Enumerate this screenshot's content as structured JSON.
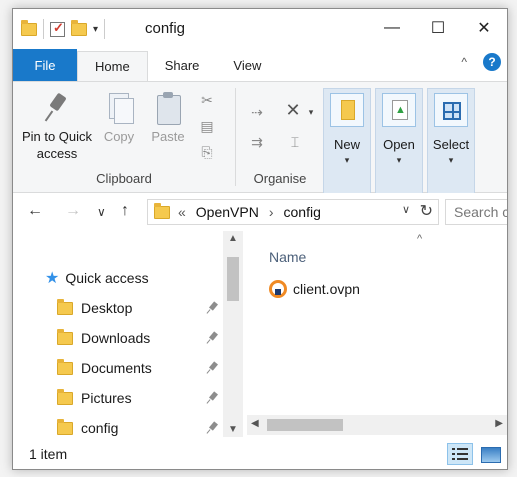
{
  "window": {
    "title": "config",
    "controls": {
      "minimize": "—",
      "maximize": "☐",
      "close": "✕"
    }
  },
  "quick_access_toolbar": {
    "caret": "▾"
  },
  "ribbon_tabs": [
    {
      "label": "File"
    },
    {
      "label": "Home",
      "active": true
    },
    {
      "label": "Share"
    },
    {
      "label": "View"
    }
  ],
  "ribbon_controls": {
    "collapse": "^",
    "help": "?"
  },
  "ribbon": {
    "clipboard": {
      "pin_label": "Pin to Quick access",
      "copy_label": "Copy",
      "paste_label": "Paste",
      "group_label": "Clipboard"
    },
    "organise": {
      "group_label": "Organise",
      "delete_glyph": "✕"
    },
    "new_label": "New",
    "open_label": "Open",
    "select_label": "Select",
    "caret": "▾"
  },
  "address": {
    "back": "←",
    "forward": "→",
    "recent": "∨",
    "up": "↑",
    "overflow": "«",
    "path": [
      "OpenVPN",
      "config"
    ],
    "separator": "›",
    "dropdown": "∨",
    "refresh": "↻",
    "search_placeholder": "Search co"
  },
  "nav_pane": {
    "quick_access_label": "Quick access",
    "items": [
      {
        "label": "Desktop",
        "pinned": true
      },
      {
        "label": "Downloads",
        "pinned": true
      },
      {
        "label": "Documents",
        "pinned": true
      },
      {
        "label": "Pictures",
        "pinned": true
      },
      {
        "label": "config",
        "pinned": true
      }
    ],
    "scroll_up": "▲",
    "scroll_down": "▼"
  },
  "content": {
    "sort_indicator": "^",
    "column_name": "Name",
    "files": [
      {
        "name": "client.ovpn",
        "icon": "openvpn-icon"
      }
    ],
    "scroll_left": "◀",
    "scroll_right": "▶"
  },
  "status": {
    "item_count": "1 item"
  },
  "colors": {
    "accent": "#1979ca",
    "folder": "#f5c94e",
    "ribbon_bg": "#f5f6f7",
    "pane_button_bg": "#dde8f3",
    "openvpn_orange": "#f08a24"
  }
}
